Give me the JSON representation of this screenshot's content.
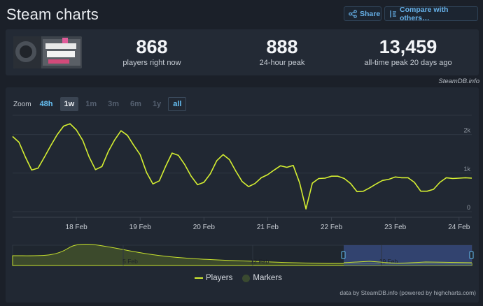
{
  "header": {
    "title": "Steam charts",
    "share_label": "Share",
    "compare_label": "Compare with others…"
  },
  "stats": [
    {
      "value": "868",
      "label": "players right now"
    },
    {
      "value": "888",
      "label": "24-hour peak"
    },
    {
      "value": "13,459",
      "label": "all-time peak 20 days ago"
    }
  ],
  "source_label": "SteamDB.info",
  "zoom": {
    "label": "Zoom",
    "options": [
      "48h",
      "1w",
      "1m",
      "3m",
      "6m",
      "1y",
      "all"
    ],
    "selected": "1w"
  },
  "legend": {
    "players": "Players",
    "markers": "Markers"
  },
  "credits": "data by SteamDB.info (powered by highcharts.com)",
  "colors": {
    "series": "#d5ef31",
    "accent": "#66c0f4",
    "background": "#1b2029",
    "panel": "#212833"
  },
  "navigator": {
    "labels": [
      "5 Feb",
      "12 Feb",
      "19 Feb"
    ]
  },
  "chart_data": {
    "type": "line",
    "x_tick_labels": [
      "18 Feb",
      "19 Feb",
      "20 Feb",
      "21 Feb",
      "22 Feb",
      "23 Feb",
      "24 Feb"
    ],
    "y_tick_labels": [
      "0",
      "1k",
      "2k"
    ],
    "ylim": [
      0,
      2500
    ],
    "xlim": [
      17.0,
      24.2
    ],
    "series": [
      {
        "name": "Players",
        "x": [
          17.0,
          17.1,
          17.2,
          17.3,
          17.4,
          17.5,
          17.6,
          17.7,
          17.8,
          17.9,
          18.0,
          18.1,
          18.2,
          18.3,
          18.4,
          18.5,
          18.6,
          18.7,
          18.8,
          18.9,
          19.0,
          19.1,
          19.2,
          19.3,
          19.4,
          19.5,
          19.6,
          19.7,
          19.8,
          19.9,
          20.0,
          20.1,
          20.2,
          20.3,
          20.4,
          20.5,
          20.6,
          20.7,
          20.8,
          20.9,
          21.0,
          21.1,
          21.2,
          21.3,
          21.4,
          21.5,
          21.6,
          21.7,
          21.8,
          21.9,
          22.0,
          22.1,
          22.2,
          22.3,
          22.4,
          22.5,
          22.6,
          22.7,
          22.8,
          22.9,
          23.0,
          23.1,
          23.2,
          23.3,
          23.4,
          23.5,
          23.6,
          23.7,
          23.8,
          23.9,
          24.0,
          24.1,
          24.2
        ],
        "y": [
          1950,
          1800,
          1420,
          1080,
          1130,
          1420,
          1720,
          2000,
          2220,
          2280,
          2120,
          1850,
          1420,
          1090,
          1170,
          1560,
          1860,
          2100,
          1980,
          1720,
          1480,
          1020,
          720,
          800,
          1180,
          1520,
          1460,
          1220,
          920,
          700,
          760,
          980,
          1320,
          1480,
          1350,
          1050,
          780,
          650,
          730,
          880,
          960,
          1080,
          1190,
          1150,
          1200,
          750,
          70,
          740,
          860,
          870,
          920,
          920,
          860,
          730,
          520,
          530,
          620,
          720,
          810,
          840,
          900,
          880,
          880,
          760,
          530,
          530,
          580,
          760,
          880,
          860,
          870,
          880,
          870
        ]
      }
    ]
  }
}
